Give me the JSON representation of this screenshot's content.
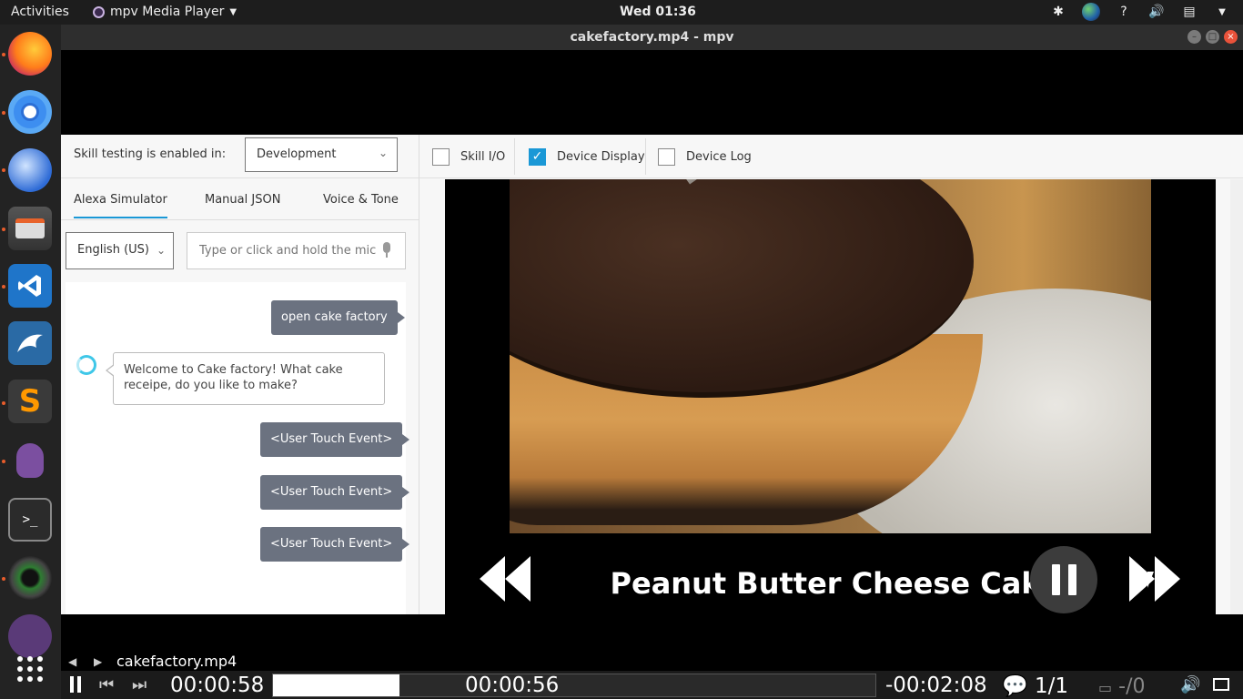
{
  "topbar": {
    "activities": "Activities",
    "app_name": "mpv Media Player",
    "clock": "Wed 01:36"
  },
  "window": {
    "title": "cakefactory.mp4 - mpv"
  },
  "dock": {
    "items": [
      "firefox-icon",
      "chromium-icon",
      "thunderbird-icon",
      "files-icon",
      "vscode-icon",
      "mysql-workbench-icon",
      "sublime-text-icon",
      "pidgin-icon",
      "terminal-icon",
      "camera-icon",
      "mpv-icon",
      "show-apps-icon"
    ]
  },
  "console": {
    "testing_label": "Skill testing is enabled in:",
    "stage": "Development",
    "tabs": [
      "Alexa Simulator",
      "Manual JSON",
      "Voice & Tone"
    ],
    "language": "English (US)",
    "input_placeholder": "Type or click and hold the mic",
    "messages": {
      "user1": "open cake factory",
      "alexa1": "Welcome to Cake factory! What cake receipe, do you like to make?",
      "user2": "<User Touch Event>",
      "user3": "<User Touch Event>",
      "user4": "<User Touch Event>"
    },
    "options": {
      "skill_io": "Skill I/O",
      "device_display": "Device Display",
      "device_log": "Device Log"
    },
    "options_checked": {
      "skill_io": false,
      "device_display": true,
      "device_log": false
    }
  },
  "device_display": {
    "title": "Peanut Butter Cheese Cake"
  },
  "osc": {
    "filename": "cakefactory.mp4",
    "elapsed": "00:00:58",
    "cache": "00:00:56",
    "remaining": "-00:02:08",
    "chapters": "1/1",
    "subtitles": "-/0",
    "progress_fraction": 0.21
  },
  "colors": {
    "accent": "#1a98d6",
    "bubble_user": "#6b7280",
    "alexa_ring": "#3fc7e8"
  }
}
